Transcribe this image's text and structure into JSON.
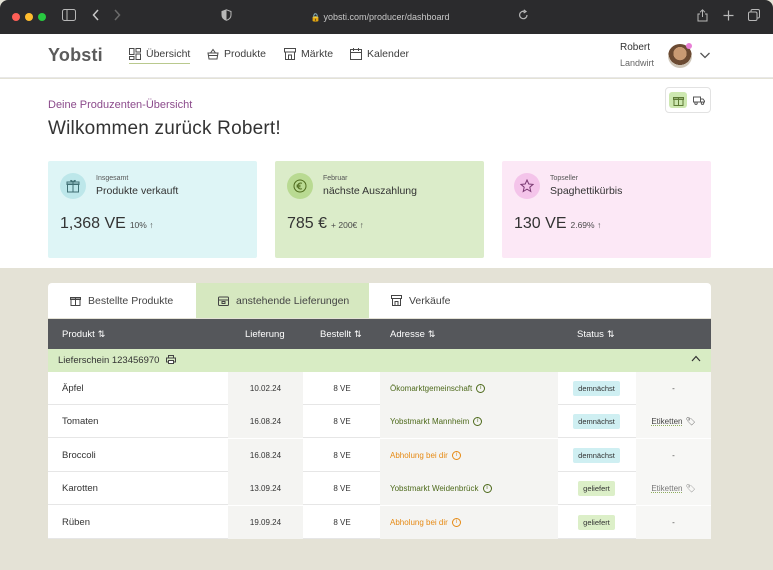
{
  "browser": {
    "url": "yobsti.com/producer/dashboard"
  },
  "header": {
    "logo": "Yobsti",
    "nav": [
      {
        "label": "Übersicht"
      },
      {
        "label": "Produkte"
      },
      {
        "label": "Märkte"
      },
      {
        "label": "Kalender"
      }
    ],
    "user": {
      "name": "Robert",
      "role": "Landwirt"
    }
  },
  "welcome": {
    "subtitle": "Deine Produzenten-Übersicht",
    "title": "Wilkommen zurück Robert!"
  },
  "cards": [
    {
      "small": "Insgesamt",
      "label": "Produkte verkauft",
      "value": "1,368 VE",
      "delta": "10% ↑",
      "color": "#def5f6",
      "icon_color": "#bde7ea",
      "icon": "box-icon"
    },
    {
      "small": "Februar",
      "label": "nächste Auszahlung",
      "value": "785 €",
      "delta": "+ 200€ ↑",
      "color": "#dbecc9",
      "icon_color": "#b9da92",
      "icon": "euro-icon"
    },
    {
      "small": "Topseller",
      "label": "Spaghettikürbis",
      "value": "130 VE",
      "delta": "2.69% ↑",
      "color": "#fce8f6",
      "icon_color": "#f4c4ea",
      "icon": "star-icon"
    }
  ],
  "tabs": [
    {
      "label": "Bestellte Produkte"
    },
    {
      "label": "anstehende Lieferungen",
      "active": true
    },
    {
      "label": "Verkäufe"
    }
  ],
  "table": {
    "headers": {
      "produkt": "Produkt",
      "lieferung": "Lieferung",
      "bestellt": "Bestellt",
      "adresse": "Adresse",
      "status": "Status"
    },
    "group": "Lieferschein 123456970",
    "rows": [
      {
        "produkt": "Äpfel",
        "lieferung": "10.02.24",
        "bestellt": "8 VE",
        "adresse": "Ökomarktgemeinschaft",
        "adresse_type": "market",
        "status": "demnächst",
        "action": "-"
      },
      {
        "produkt": "Tomaten",
        "lieferung": "16.08.24",
        "bestellt": "8 VE",
        "adresse": "Yobstmarkt Mannheim",
        "adresse_type": "market",
        "status": "demnächst",
        "action": "Etiketten"
      },
      {
        "produkt": "Broccoli",
        "lieferung": "16.08.24",
        "bestellt": "8 VE",
        "adresse": "Abholung bei dir",
        "adresse_type": "pickup",
        "status": "demnächst",
        "action": "-"
      },
      {
        "produkt": "Karotten",
        "lieferung": "13.09.24",
        "bestellt": "8 VE",
        "adresse": "Yobstmarkt Weidenbrück",
        "adresse_type": "market",
        "status": "geliefert",
        "action": "Etiketten"
      },
      {
        "produkt": "Rüben",
        "lieferung": "19.09.24",
        "bestellt": "8 VE",
        "adresse": "Abholung bei dir",
        "adresse_type": "pickup",
        "status": "geliefert",
        "action": "-"
      }
    ]
  },
  "colors": {
    "accent_green": "#b9da92",
    "table_header": "#55575b",
    "pickup_orange": "#e68a14",
    "market_green": "#4e6a1c"
  }
}
